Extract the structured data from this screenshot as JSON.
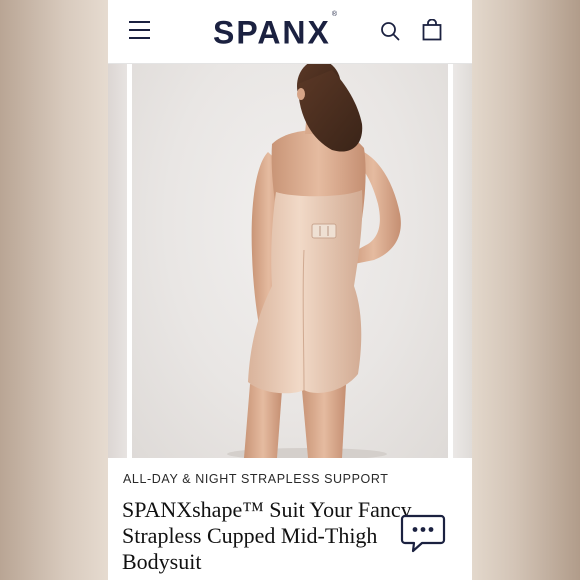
{
  "header": {
    "logo_text": "SPANX",
    "logo_mark": "®",
    "icons": [
      "menu-icon",
      "search-icon",
      "shopping-bag-icon"
    ]
  },
  "product": {
    "eyebrow": "ALL-DAY & NIGHT STRAPLESS SUPPORT",
    "title": "SPANXshape™ Suit Your Fancy Strapless Cupped Mid-Thigh Bodysuit"
  },
  "chat": {
    "icon": "chat-bubble-icon"
  },
  "colors": {
    "brand_navy": "#1b2140",
    "skin": "#e0b79c",
    "garment": "#e8cbb6",
    "photo_bg": "#ebe8e6"
  }
}
